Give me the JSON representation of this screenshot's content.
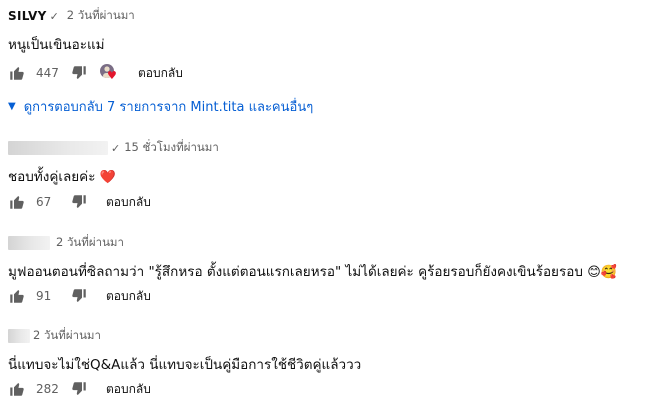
{
  "comments": [
    {
      "author": "SILVY",
      "verified": "✓",
      "time": "2 วันที่ผ่านมา",
      "text": "หนูเป็นเขินอะแม่",
      "likes": "447",
      "reply_label": "ตอบกลับ",
      "hearted": true,
      "view_replies": "ดูการตอบกลับ 7 รายการจาก Mint.tita และคนอื่นๆ"
    },
    {
      "author": "",
      "verified": "✓",
      "time": "15 ชั่วโมงที่ผ่านมา",
      "text": "ชอบทั้งคู่เลยค่ะ",
      "likes": "67",
      "reply_label": "ตอบกลับ"
    },
    {
      "author": "",
      "time": "2 วันที่ผ่านมา",
      "text": "มูฟออนตอนที่ซิลถามว่า \"รู้สึกหรอ ตั้งแต่ตอนแรกเลยหรอ\" ไม่ได้เลยค่ะ คูร้อยรอบก็ยังคงเขินร้อยรอบ",
      "likes": "91",
      "reply_label": "ตอบกลับ"
    },
    {
      "author": "",
      "time": "2 วันที่ผ่านมา",
      "text": "นี่แทบจะไม่ใช่Q&Aแล้ว นี่แทบจะเป็นคู่มือการใช้ชีวิตคู่แล้ววว",
      "likes": "282",
      "reply_label": "ตอบกลับ"
    }
  ],
  "emoji": {
    "heart": "❤️",
    "smile": "😊",
    "heart_eyes": "🥰"
  },
  "colors": {
    "link": "#065fd4",
    "secondary_text": "#606060",
    "heart": "#e3162d"
  },
  "icons": [
    "thumbs-up-icon",
    "thumbs-down-icon",
    "chevron-down-icon",
    "verified-check-icon",
    "heart-icon"
  ]
}
